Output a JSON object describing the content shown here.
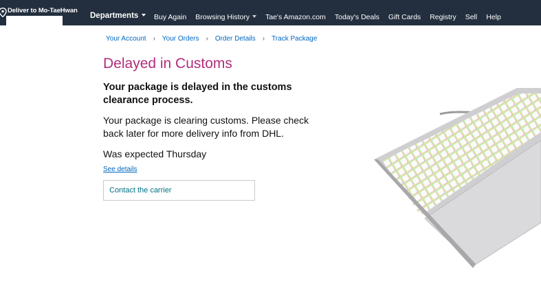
{
  "nav": {
    "deliver_label": "Deliver to Mo-TaeHwan",
    "departments_label": "Departments",
    "links": [
      {
        "label": "Buy Again"
      },
      {
        "label": "Browsing History"
      },
      {
        "label": "Tae's Amazon.com"
      },
      {
        "label": "Today's Deals"
      },
      {
        "label": "Gift Cards"
      },
      {
        "label": "Registry"
      },
      {
        "label": "Sell"
      },
      {
        "label": "Help"
      }
    ]
  },
  "breadcrumb": [
    "Your Account",
    "Your Orders",
    "Order Details",
    "Track Package"
  ],
  "breadcrumb_separator": "›",
  "tracking": {
    "status_title": "Delayed in Customs",
    "headline": "Your package is delayed in the customs clearance process.",
    "detail": "Your package is clearing customs. Please check back later for more delivery info from DHL.",
    "expected": "Was expected Thursday",
    "see_details_link": "See details",
    "contact_carrier_button": "Contact the carrier"
  },
  "colors": {
    "nav_background": "#232f3e",
    "status_title": "#b12d7a",
    "link": "#0066c0",
    "button_text": "#007185"
  },
  "icons": {
    "deliver": "location-pin-icon",
    "departments_dropdown": "caret-down-icon",
    "browsing_history_dropdown": "caret-down-icon"
  },
  "product_image": "keyboard-image"
}
